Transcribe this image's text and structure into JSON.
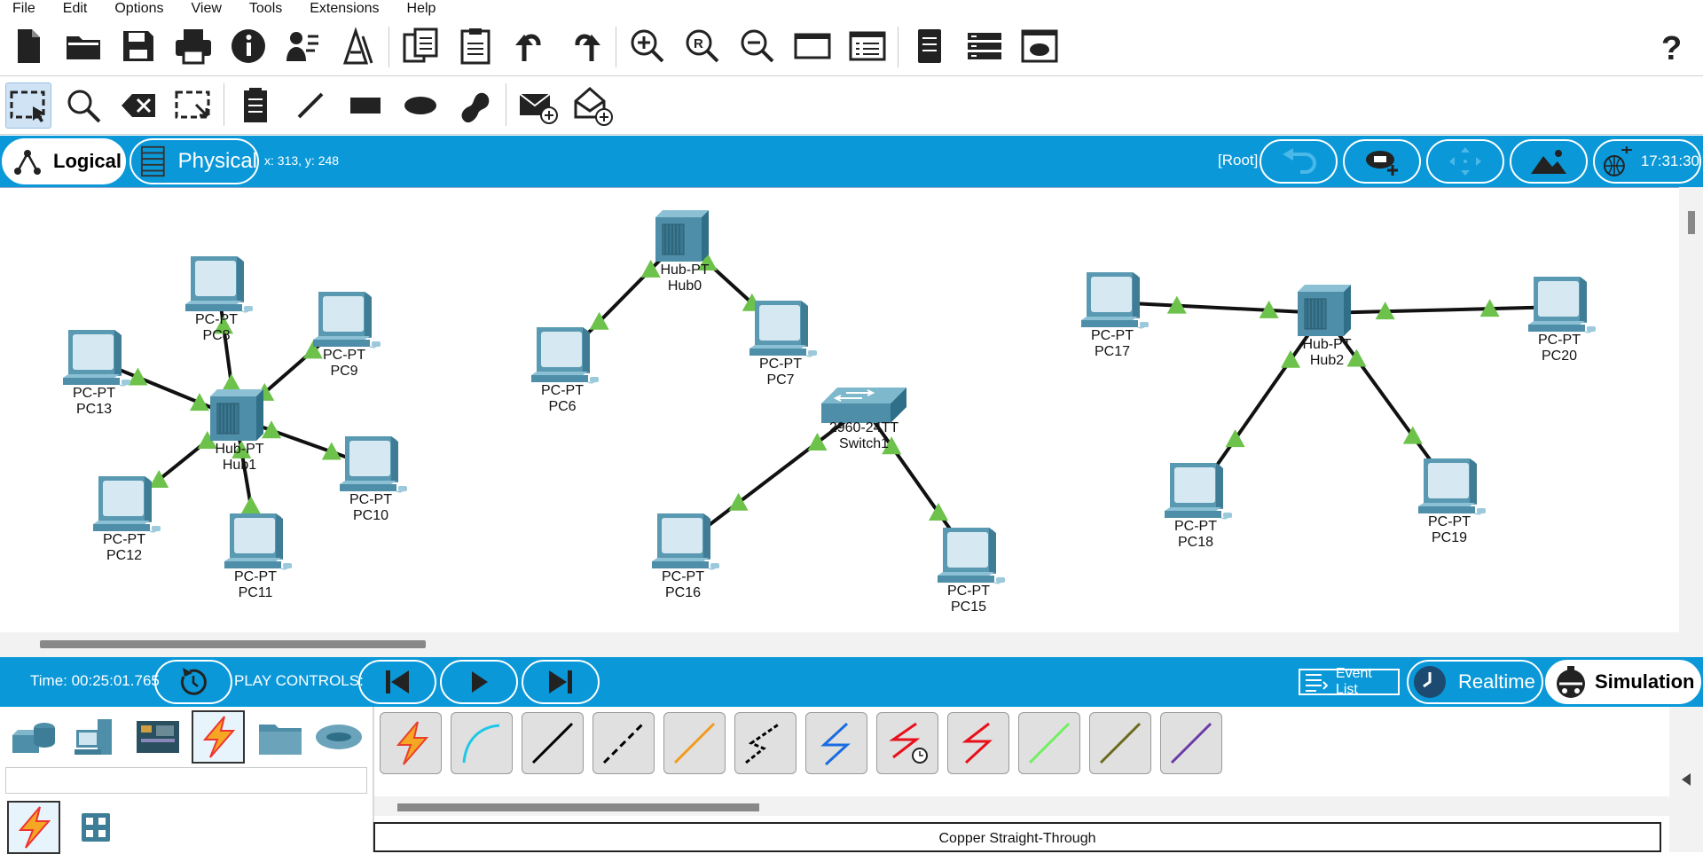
{
  "menu": [
    "File",
    "Edit",
    "Options",
    "View",
    "Tools",
    "Extensions",
    "Help"
  ],
  "toolbar_main": [
    {
      "icon": "new-file-icon"
    },
    {
      "icon": "open-folder-icon"
    },
    {
      "icon": "save-icon"
    },
    {
      "icon": "print-icon"
    },
    {
      "icon": "info-icon"
    },
    {
      "icon": "activity-wizard-icon"
    },
    {
      "icon": "pdu-icon"
    },
    {
      "icon": "copy-icon"
    },
    {
      "icon": "paste-icon"
    },
    {
      "icon": "undo-icon"
    },
    {
      "icon": "redo-icon"
    },
    {
      "icon": "zoom-in-icon"
    },
    {
      "icon": "zoom-reset-icon"
    },
    {
      "icon": "zoom-out-icon"
    },
    {
      "icon": "window-icon"
    },
    {
      "icon": "list-view-icon"
    },
    {
      "icon": "document-icon"
    },
    {
      "icon": "rack-icon"
    },
    {
      "icon": "cloud-window-icon"
    },
    {
      "icon": "help-icon"
    }
  ],
  "toolbar_tools": [
    {
      "icon": "select-icon",
      "selected": true
    },
    {
      "icon": "inspect-icon"
    },
    {
      "icon": "delete-icon"
    },
    {
      "icon": "resize-icon"
    },
    {
      "icon": "note-icon"
    },
    {
      "icon": "draw-line-icon"
    },
    {
      "icon": "draw-rectangle-icon"
    },
    {
      "icon": "draw-ellipse-icon"
    },
    {
      "icon": "freeform-icon"
    },
    {
      "icon": "add-simple-pdu-icon"
    },
    {
      "icon": "add-complex-pdu-icon"
    }
  ],
  "workspace": {
    "logical_label": "Logical",
    "physical_label": "Physical",
    "coordinates": "x: 313, y: 248",
    "root_label": "[Root]",
    "clock": "17:31:30"
  },
  "devices": [
    {
      "id": "PC8",
      "type": "PC-PT",
      "kind": "pc"
    },
    {
      "id": "PC9",
      "type": "PC-PT",
      "kind": "pc"
    },
    {
      "id": "PC13",
      "type": "PC-PT",
      "kind": "pc"
    },
    {
      "id": "Hub1",
      "type": "Hub-PT",
      "kind": "hub"
    },
    {
      "id": "PC10",
      "type": "PC-PT",
      "kind": "pc"
    },
    {
      "id": "PC12",
      "type": "PC-PT",
      "kind": "pc"
    },
    {
      "id": "PC11",
      "type": "PC-PT",
      "kind": "pc"
    },
    {
      "id": "Hub0",
      "type": "Hub-PT",
      "kind": "hub"
    },
    {
      "id": "PC6",
      "type": "PC-PT",
      "kind": "pc"
    },
    {
      "id": "PC7",
      "type": "PC-PT",
      "kind": "pc"
    },
    {
      "id": "Switch1",
      "type": "2960-24TT",
      "kind": "switch"
    },
    {
      "id": "PC16",
      "type": "PC-PT",
      "kind": "pc"
    },
    {
      "id": "PC15",
      "type": "PC-PT",
      "kind": "pc"
    },
    {
      "id": "PC17",
      "type": "PC-PT",
      "kind": "pc"
    },
    {
      "id": "Hub2",
      "type": "Hub-PT",
      "kind": "hub"
    },
    {
      "id": "PC20",
      "type": "PC-PT",
      "kind": "pc"
    },
    {
      "id": "PC18",
      "type": "PC-PT",
      "kind": "pc"
    },
    {
      "id": "PC19",
      "type": "PC-PT",
      "kind": "pc"
    }
  ],
  "links": [
    {
      "from": "Hub1",
      "to": "PC8"
    },
    {
      "from": "Hub1",
      "to": "PC9"
    },
    {
      "from": "Hub1",
      "to": "PC13"
    },
    {
      "from": "Hub1",
      "to": "PC10"
    },
    {
      "from": "Hub1",
      "to": "PC12"
    },
    {
      "from": "Hub1",
      "to": "PC11"
    },
    {
      "from": "Hub0",
      "to": "PC6"
    },
    {
      "from": "Hub0",
      "to": "PC7"
    },
    {
      "from": "Switch1",
      "to": "PC16"
    },
    {
      "from": "Switch1",
      "to": "PC15"
    },
    {
      "from": "Hub2",
      "to": "PC17"
    },
    {
      "from": "Hub2",
      "to": "PC20"
    },
    {
      "from": "Hub2",
      "to": "PC18"
    },
    {
      "from": "Hub2",
      "to": "PC19"
    }
  ],
  "link_status_color": "#6cc24a",
  "simulation": {
    "time": "Time: 00:25:01.765",
    "play_controls_label": "PLAY CONTROLS:",
    "event_list_label": "Event List",
    "realtime_label": "Realtime",
    "simulation_label": "Simulation"
  },
  "device_categories": [
    {
      "icon": "network-devices-icon"
    },
    {
      "icon": "end-devices-icon"
    },
    {
      "icon": "components-icon"
    },
    {
      "icon": "connections-icon",
      "selected": true
    },
    {
      "icon": "miscellaneous-icon"
    },
    {
      "icon": "multiuser-icon"
    }
  ],
  "subcategories": [
    {
      "icon": "connections-sub-icon",
      "selected": true
    },
    {
      "icon": "grid-icon"
    }
  ],
  "cables": [
    {
      "icon": "automatic-connection-icon",
      "color": "#e8402a"
    },
    {
      "icon": "console-cable-icon",
      "color": "#1ec8e6"
    },
    {
      "icon": "copper-straight-through-icon",
      "color": "#000000"
    },
    {
      "icon": "copper-cross-over-icon",
      "color": "#000000"
    },
    {
      "icon": "fiber-icon",
      "color": "#f39a1e"
    },
    {
      "icon": "phone-cable-icon",
      "color": "#000000"
    },
    {
      "icon": "coaxial-icon",
      "color": "#1a6ce0"
    },
    {
      "icon": "serial-dce-icon",
      "color": "#e8101a"
    },
    {
      "icon": "serial-dte-icon",
      "color": "#e8101a"
    },
    {
      "icon": "octal-cable-icon",
      "color": "#6ef060"
    },
    {
      "icon": "iot-custom-cable-icon",
      "color": "#6b6a1e"
    },
    {
      "icon": "usb-cable-icon",
      "color": "#6a3aa8"
    }
  ],
  "cable_description": "Copper Straight-Through"
}
